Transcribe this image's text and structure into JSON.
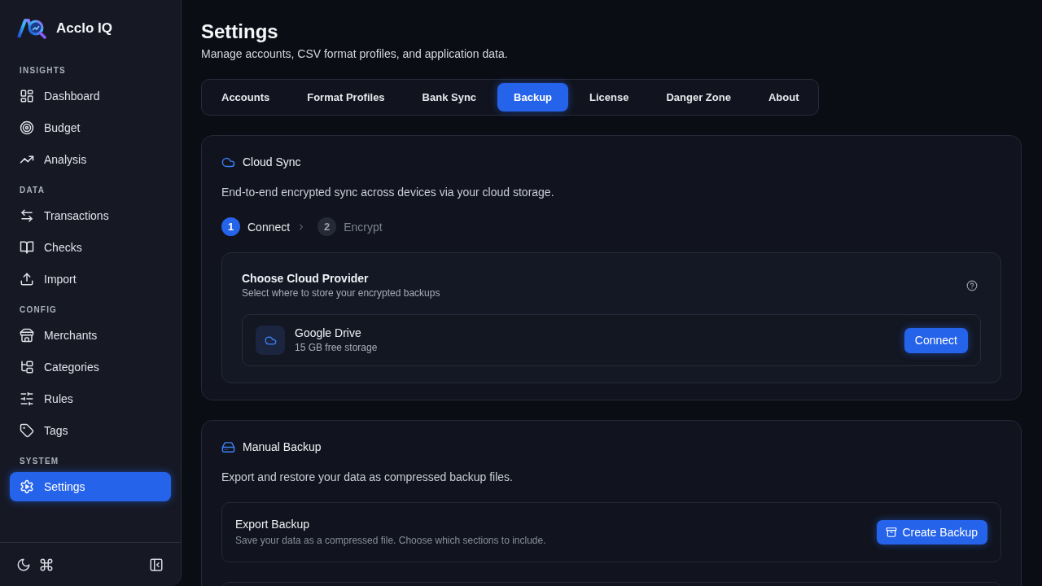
{
  "sidebar": {
    "brand": "Acclo IQ",
    "sections": [
      {
        "heading": "INSIGHTS",
        "items": [
          {
            "label": "Dashboard",
            "selected": false
          },
          {
            "label": "Budget",
            "selected": false
          },
          {
            "label": "Analysis",
            "selected": false
          }
        ]
      },
      {
        "heading": "DATA",
        "items": [
          {
            "label": "Transactions",
            "selected": false
          },
          {
            "label": "Checks",
            "selected": false
          },
          {
            "label": "Import",
            "selected": false
          }
        ]
      },
      {
        "heading": "CONFIG",
        "items": [
          {
            "label": "Merchants",
            "selected": false
          },
          {
            "label": "Categories",
            "selected": false
          },
          {
            "label": "Rules",
            "selected": false
          },
          {
            "label": "Tags",
            "selected": false
          }
        ]
      },
      {
        "heading": "SYSTEM",
        "items": [
          {
            "label": "Settings",
            "selected": true
          }
        ]
      }
    ]
  },
  "page": {
    "title": "Settings",
    "subtitle": "Manage accounts, CSV format profiles, and application data."
  },
  "tabs": [
    {
      "label": "Accounts",
      "selected": false
    },
    {
      "label": "Format Profiles",
      "selected": false
    },
    {
      "label": "Bank Sync",
      "selected": false
    },
    {
      "label": "Backup",
      "selected": true
    },
    {
      "label": "License",
      "selected": false
    },
    {
      "label": "Danger Zone",
      "selected": false
    },
    {
      "label": "About",
      "selected": false
    }
  ],
  "cloud_sync": {
    "title": "Cloud Sync",
    "description": "End-to-end encrypted sync across devices via your cloud storage.",
    "steps": [
      {
        "number": "1",
        "label": "Connect",
        "active": true
      },
      {
        "number": "2",
        "label": "Encrypt",
        "active": false
      }
    ],
    "provider_panel": {
      "title": "Choose Cloud Provider",
      "subtitle": "Select where to store your encrypted backups",
      "providers": [
        {
          "name": "Google Drive",
          "detail": "15 GB free storage",
          "action": "Connect"
        }
      ]
    }
  },
  "manual_backup": {
    "title": "Manual Backup",
    "description": "Export and restore your data as compressed backup files.",
    "rows": [
      {
        "title": "Export Backup",
        "subtitle": "Save your data as a compressed file. Choose which sections to include.",
        "action": "Create Backup"
      }
    ]
  }
}
